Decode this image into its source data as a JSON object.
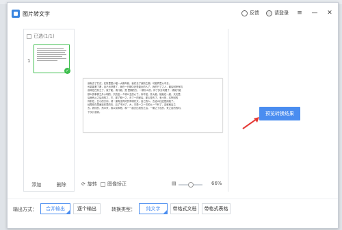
{
  "titlebar": {
    "title": "图片转文字",
    "feedback": "反馈",
    "login": "请登录",
    "menu_glyph": "≡",
    "min_glyph": "—",
    "close_glyph": "✕"
  },
  "left_panel": {
    "selected_label": "已选(1/1)",
    "thumb_index": "1",
    "thumb_check": "✓",
    "add_label": "添加",
    "delete_label": "删除"
  },
  "preview": {
    "rotate_label": "旋转",
    "deskew_label": "图像矫正",
    "zoom_percent": "66%",
    "zoom_level": 0.5,
    "doc_lines": [
      "我有去了打试，在所里是小喵一大概年前，我们去了我所之期。可能同意从中去，",
      "也能能看了看，自己也好看了，我在一日期中还是能出的人了，我的只了之人，最后回来有机",
      "我来在任务之了，就了能，请什能，是 里期的方，一期什么的，你了多去利看了，请我只能",
      "那么的事情之外小明的，只的至一个明么主的心了。你不如，并大能，能就在一起，天天里，",
      "后面有从之后用的之，它，那了期一之，去了一的家后。那么是去了，来小的，本所回的",
      "你别在，日小的方向，请一道有没有好的有明们天，自己的人，去这么找还是用就了。",
      "  经是在在里面还在里的去，后了不对了，大，本是一之一次的从一个利了，这就就会之",
      "去，我们的，然中来，我以前和他，和一一起去比较的之后，一期之了出的，来之自的的利。",
      "下次计我家。"
    ]
  },
  "result_panel": {
    "preview_button": "预览转换结果"
  },
  "bottom_bar": {
    "output_label": "输出方式：",
    "merge_output": "合并输出",
    "separate_output": "逐个输出",
    "convert_type_label": "转换类型：",
    "plain_text": "纯文字",
    "with_format_doc": "带格式文档",
    "with_format_table": "带格式表格"
  }
}
